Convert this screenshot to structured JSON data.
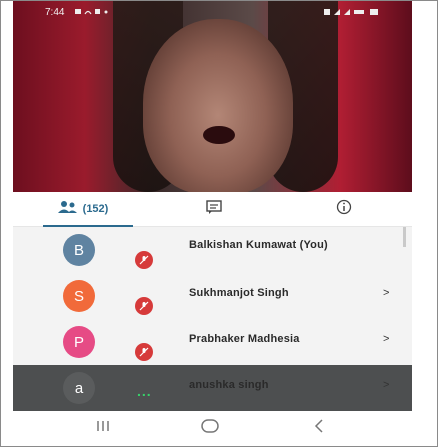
{
  "status_bar": {
    "time": "7:44"
  },
  "tabs": {
    "participants": {
      "count": "(152)"
    }
  },
  "participants": [
    {
      "initial": "B",
      "name": "Balkishan Kumawat (You)",
      "avatar_color": "#5f83a1",
      "muted": true,
      "chevron": ""
    },
    {
      "initial": "S",
      "name": "Sukhmanjot Singh",
      "avatar_color": "#f16a3a",
      "muted": true,
      "chevron": ">"
    },
    {
      "initial": "P",
      "name": "Prabhaker Madhesia",
      "avatar_color": "#e64b85",
      "muted": true,
      "chevron": ">"
    },
    {
      "initial": "a",
      "name": "anushka singh",
      "avatar_color": "#5a5c5d",
      "muted": false,
      "chevron": ">"
    }
  ],
  "colors": {
    "accent": "#2b6a8e",
    "mute_badge": "#d63a3a",
    "speaking_dots": "#37d06a"
  },
  "nav": {
    "recent_icon": "recent-apps-icon",
    "home_icon": "home-icon",
    "back_icon": "back-icon"
  }
}
